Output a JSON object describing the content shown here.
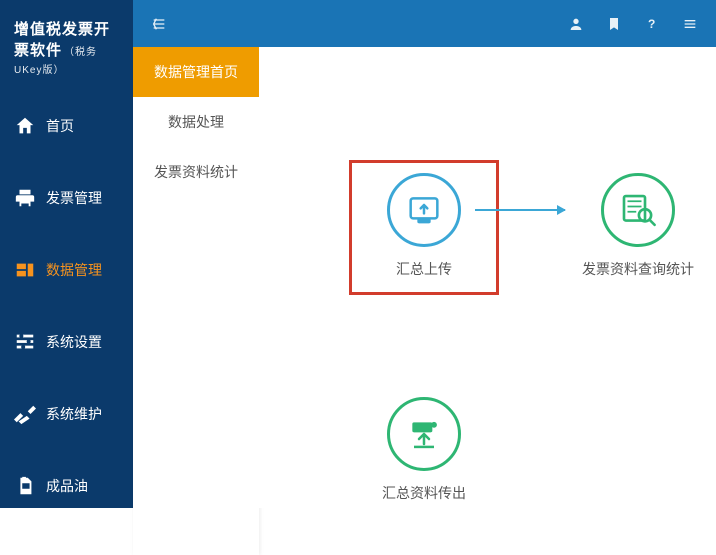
{
  "logo": {
    "title": "增值税发票开票软件",
    "subtitle": "（税务UKey版）"
  },
  "sidebar": {
    "items": [
      {
        "label": "首页"
      },
      {
        "label": "发票管理"
      },
      {
        "label": "数据管理"
      },
      {
        "label": "系统设置"
      },
      {
        "label": "系统维护"
      },
      {
        "label": "成品油"
      }
    ]
  },
  "submenu": {
    "items": [
      {
        "label": "数据管理首页"
      },
      {
        "label": "数据处理"
      },
      {
        "label": "发票资料统计"
      }
    ]
  },
  "tiles": {
    "upload": {
      "label": "汇总上传"
    },
    "query": {
      "label": "发票资料查询统计"
    },
    "export": {
      "label": "汇总资料传出"
    }
  },
  "colors": {
    "sidebar": "#0b3a6b",
    "topbar": "#1a74b5",
    "accent": "#ef9c00",
    "green": "#2eb673",
    "blue": "#3ba7d6",
    "highlight": "#d23c2c"
  }
}
